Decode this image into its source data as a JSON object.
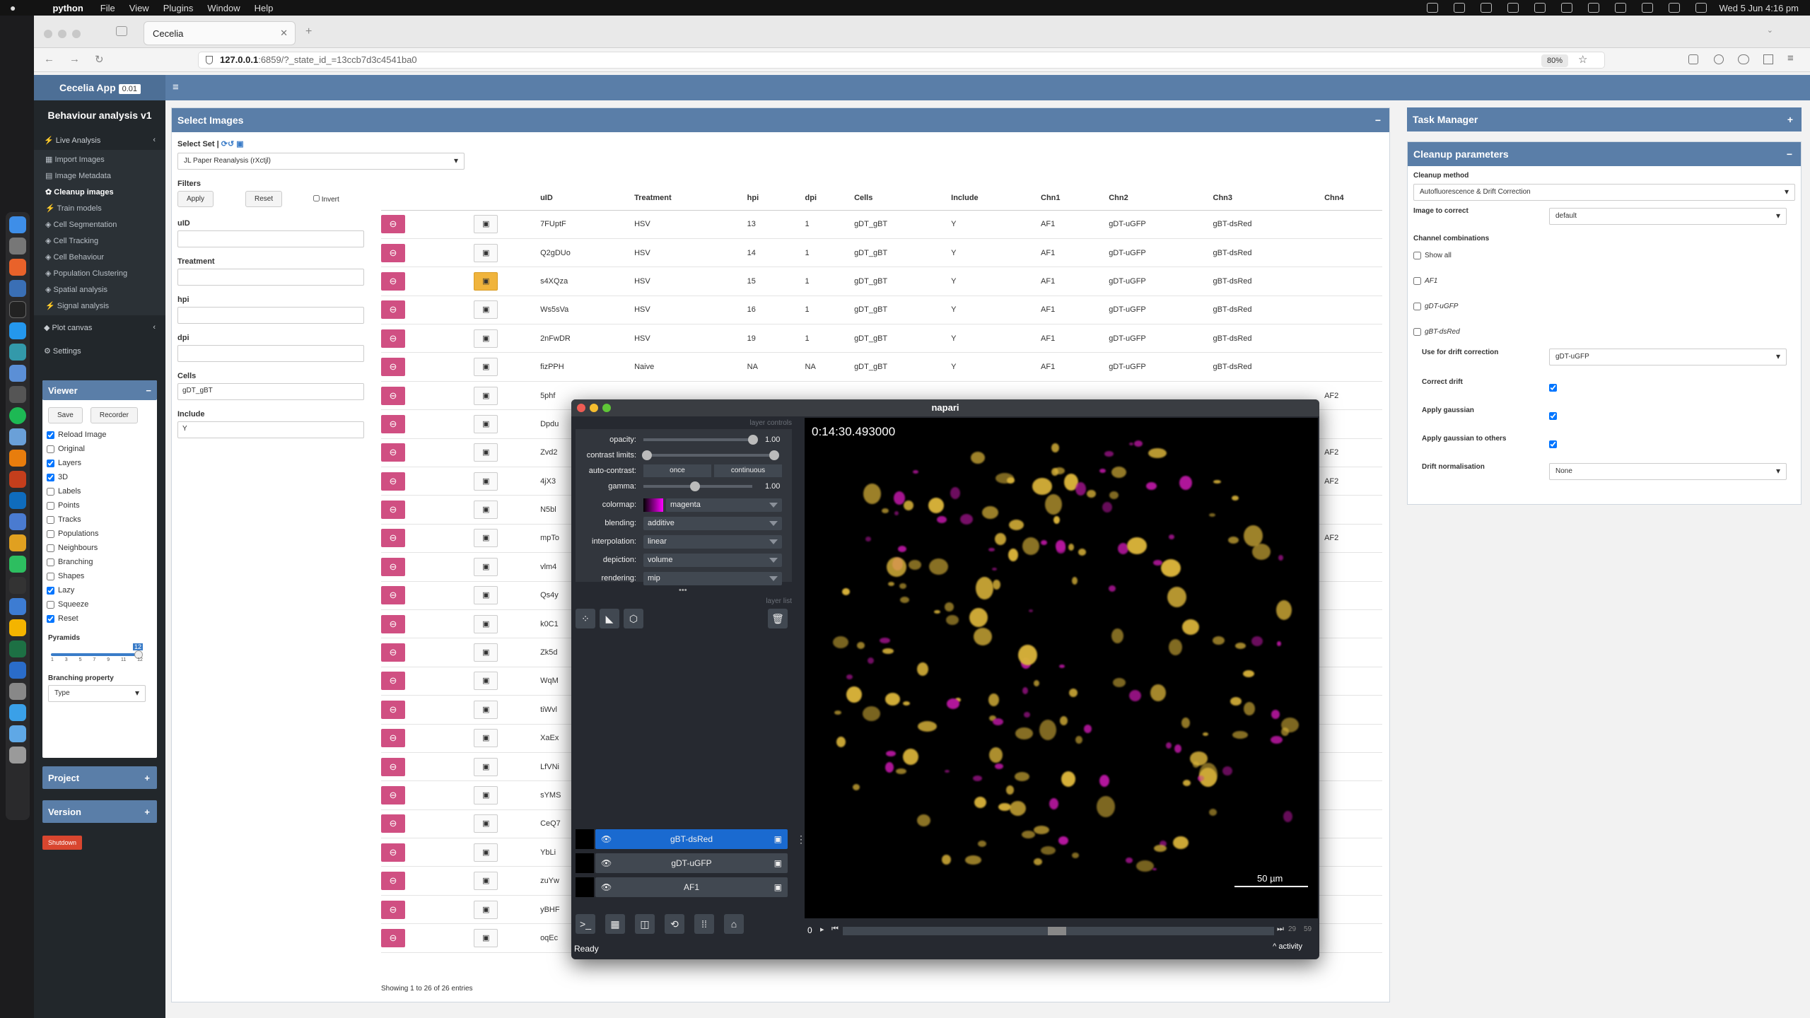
{
  "macos": {
    "apple": "",
    "app": "python",
    "menus": [
      "File",
      "View",
      "Plugins",
      "Window",
      "Help"
    ],
    "clock": "Wed 5 Jun  4:16 pm"
  },
  "browser": {
    "tab_title": "Cecelia",
    "url_host": "127.0.0.1",
    "url_rest": ":6859/?_state_id_=13ccb7d3c4541ba0",
    "zoom": "80%"
  },
  "app": {
    "brand": "Cecelia App",
    "version": "0.01",
    "project_title": "Behaviour analysis v1"
  },
  "sidebar": {
    "live_analysis": "Live Analysis",
    "items": [
      "Import Images",
      "Image Metadata",
      "Cleanup images",
      "Train models",
      "Cell Segmentation",
      "Cell Tracking",
      "Cell Behaviour",
      "Population Clustering",
      "Spatial analysis",
      "Signal analysis"
    ],
    "plot_canvas": "Plot canvas",
    "settings": "Settings"
  },
  "viewer": {
    "title": "Viewer",
    "save": "Save",
    "recorder": "Recorder",
    "options": [
      {
        "label": "Reload Image",
        "checked": true
      },
      {
        "label": "Original",
        "checked": false
      },
      {
        "label": "Layers",
        "checked": true
      },
      {
        "label": "3D",
        "checked": true
      },
      {
        "label": "Labels",
        "checked": false
      },
      {
        "label": "Points",
        "checked": false
      },
      {
        "label": "Tracks",
        "checked": false
      },
      {
        "label": "Populations",
        "checked": false
      },
      {
        "label": "Neighbours",
        "checked": false
      },
      {
        "label": "Branching",
        "checked": false
      },
      {
        "label": "Shapes",
        "checked": false
      },
      {
        "label": "Lazy",
        "checked": true
      },
      {
        "label": "Squeeze",
        "checked": false
      },
      {
        "label": "Reset",
        "checked": true
      }
    ],
    "pyramids_label": "Pyramids",
    "pyramids_value": "12",
    "pyramid_ticks": [
      "1",
      "3",
      "5",
      "7",
      "9",
      "11",
      "12"
    ],
    "branching_label": "Branching property",
    "branching_value": "Type"
  },
  "project_box": "Project",
  "version_box": "Version",
  "shutdown": "Shutdown",
  "select_images": {
    "title": "Select Images",
    "select_set_label": "Select Set |",
    "select_set_value": "JL Paper Reanalysis (rXctjl)",
    "filters": "Filters",
    "apply": "Apply",
    "reset": "Reset",
    "invert": "Invert",
    "filter_fields": [
      {
        "label": "uID",
        "value": ""
      },
      {
        "label": "Treatment",
        "value": ""
      },
      {
        "label": "hpi",
        "value": ""
      },
      {
        "label": "dpi",
        "value": ""
      },
      {
        "label": "Cells",
        "value": "gDT_gBT"
      },
      {
        "label": "Include",
        "value": "Y"
      }
    ],
    "columns": [
      "uID",
      "Treatment",
      "hpi",
      "dpi",
      "Cells",
      "Include",
      "Chn1",
      "Chn2",
      "Chn3",
      "Chn4"
    ],
    "rows": [
      [
        "7FUptF",
        "HSV",
        "13",
        "1",
        "gDT_gBT",
        "Y",
        "AF1",
        "gDT-uGFP",
        "gBT-dsRed",
        ""
      ],
      [
        "Q2gDUo",
        "HSV",
        "14",
        "1",
        "gDT_gBT",
        "Y",
        "AF1",
        "gDT-uGFP",
        "gBT-dsRed",
        ""
      ],
      [
        "s4XQza",
        "HSV",
        "15",
        "1",
        "gDT_gBT",
        "Y",
        "AF1",
        "gDT-uGFP",
        "gBT-dsRed",
        ""
      ],
      [
        "Ws5sVa",
        "HSV",
        "16",
        "1",
        "gDT_gBT",
        "Y",
        "AF1",
        "gDT-uGFP",
        "gBT-dsRed",
        ""
      ],
      [
        "2nFwDR",
        "HSV",
        "19",
        "1",
        "gDT_gBT",
        "Y",
        "AF1",
        "gDT-uGFP",
        "gBT-dsRed",
        ""
      ],
      [
        "fizPPH",
        "Naive",
        "NA",
        "NA",
        "gDT_gBT",
        "Y",
        "AF1",
        "gDT-uGFP",
        "gBT-dsRed",
        ""
      ],
      [
        "5phf",
        "",
        "",
        "",
        "",
        "",
        "",
        "",
        "",
        "AF2"
      ],
      [
        "Dpdu",
        "",
        "",
        "",
        "",
        "",
        "",
        "",
        "",
        ""
      ],
      [
        "Zvd2",
        "",
        "",
        "",
        "",
        "",
        "",
        "",
        "",
        "AF2"
      ],
      [
        "4jX3",
        "",
        "",
        "",
        "",
        "",
        "",
        "",
        "",
        "AF2"
      ],
      [
        "N5bl",
        "",
        "",
        "",
        "",
        "",
        "",
        "",
        "",
        ""
      ],
      [
        "mpTo",
        "",
        "",
        "",
        "",
        "",
        "",
        "",
        "",
        "AF2"
      ],
      [
        "vlm4",
        "",
        "",
        "",
        "",
        "",
        "",
        "",
        "",
        ""
      ],
      [
        "Qs4y",
        "",
        "",
        "",
        "",
        "",
        "",
        "",
        "",
        ""
      ],
      [
        "k0C1",
        "",
        "",
        "",
        "",
        "",
        "",
        "",
        "",
        ""
      ],
      [
        "Zk5d",
        "",
        "",
        "",
        "",
        "",
        "",
        "",
        "",
        ""
      ],
      [
        "WqM",
        "",
        "",
        "",
        "",
        "",
        "",
        "",
        "",
        ""
      ],
      [
        "tiWvl",
        "",
        "",
        "",
        "",
        "",
        "",
        "",
        "",
        ""
      ],
      [
        "XaEx",
        "",
        "",
        "",
        "",
        "",
        "",
        "",
        "",
        ""
      ],
      [
        "LfVNi",
        "",
        "",
        "",
        "",
        "",
        "",
        "",
        "",
        ""
      ],
      [
        "sYMS",
        "",
        "",
        "",
        "",
        "",
        "",
        "",
        "",
        ""
      ],
      [
        "CeQ7",
        "",
        "",
        "",
        "",
        "",
        "",
        "",
        "",
        ""
      ],
      [
        "YbLi",
        "",
        "",
        "",
        "",
        "",
        "",
        "",
        "",
        ""
      ],
      [
        "zuYw",
        "",
        "",
        "",
        "",
        "",
        "",
        "",
        "",
        ""
      ],
      [
        "yBHF",
        "",
        "",
        "",
        "",
        "",
        "",
        "",
        "",
        ""
      ],
      [
        "oqEc",
        "",
        "",
        "",
        "",
        "",
        "",
        "",
        "",
        ""
      ]
    ],
    "highlight_row": 2,
    "footer": "Showing 1 to 26 of 26 entries"
  },
  "task_manager": "Task Manager",
  "cleanup": {
    "title": "Cleanup parameters",
    "method_label": "Cleanup method",
    "method_value": "Autofluorescence & Drift Correction",
    "image_label": "Image to correct",
    "image_value": "default",
    "combos_label": "Channel combinations",
    "combos": [
      "Show all",
      "AF1",
      "gDT-uGFP",
      "gBT-dsRed"
    ],
    "drift_label": "Use for drift correction",
    "drift_value": "gDT-uGFP",
    "correct_drift": "Correct drift",
    "apply_gaussian": "Apply gaussian",
    "apply_gaussian_others": "Apply gaussian to others",
    "norm_label": "Drift normalisation",
    "norm_value": "None"
  },
  "napari": {
    "title": "napari",
    "layer_controls": "layer controls",
    "layer_list": "layer list",
    "opacity_label": "opacity:",
    "opacity": "1.00",
    "contrast_label": "contrast limits:",
    "autocontrast_label": "auto-contrast:",
    "once": "once",
    "continuous": "continuous",
    "gamma_label": "gamma:",
    "gamma": "1.00",
    "colormap_label": "colormap:",
    "colormap": "magenta",
    "blending_label": "blending:",
    "blending": "additive",
    "interp_label": "interpolation:",
    "interp": "linear",
    "depiction_label": "depiction:",
    "depiction": "volume",
    "rendering_label": "rendering:",
    "rendering": "mip",
    "layers": [
      "gBT-dsRed",
      "gDT-uGFP",
      "AF1"
    ],
    "timestamp": "0:14:30.493000",
    "scale": "50 µm",
    "t_start": "0",
    "t_current": "29",
    "t_end": "59",
    "status": "Ready",
    "activity": "activity",
    "colors": {
      "yellow": "#d8b23a",
      "magenta": "#b5179e"
    },
    "opacity_value": 1.0,
    "gamma_value": 1.0
  }
}
